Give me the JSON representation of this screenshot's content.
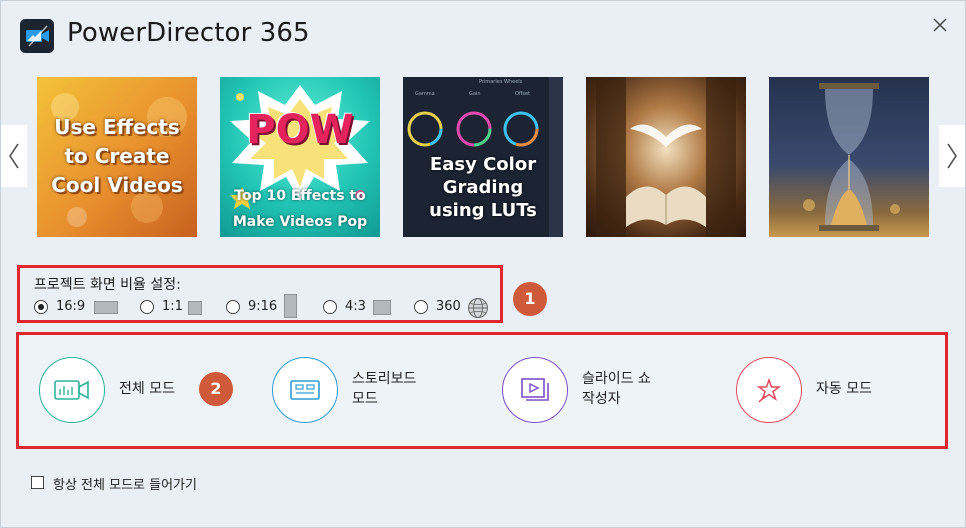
{
  "app": {
    "title": "PowerDirector 365",
    "close_icon": "close-icon"
  },
  "carousel": {
    "items": [
      {
        "caption_lines": [
          "Use Effects",
          "to Create",
          "Cool Videos"
        ]
      },
      {
        "badge": "POW",
        "caption_lines": [
          "Top 10 Effects to",
          "Make Videos Pop"
        ]
      },
      {
        "caption_lines": [
          "Easy Color",
          "Grading",
          "using LUTs"
        ],
        "ui_labels": [
          "Gamma",
          "Gain",
          "Offset",
          "Primaries Wheels"
        ]
      },
      {
        "caption_lines": []
      },
      {
        "caption_lines": []
      }
    ]
  },
  "aspect": {
    "label": "프로젝트 화면 비율 설정:",
    "options": [
      {
        "label": "16:9",
        "checked": true
      },
      {
        "label": "1:1",
        "checked": false
      },
      {
        "label": "9:16",
        "checked": false
      },
      {
        "label": "4:3",
        "checked": false
      },
      {
        "label": "360",
        "checked": false
      }
    ],
    "badge": "1"
  },
  "modes": {
    "items": [
      {
        "label_lines": [
          "전체 모드"
        ],
        "icon": "timeline-camera-icon",
        "color": "#2db29a"
      },
      {
        "label_lines": [
          "스토리보드",
          "모드"
        ],
        "icon": "storyboard-icon",
        "color": "#2e9bd6"
      },
      {
        "label_lines": [
          "슬라이드 쇼",
          "작성자"
        ],
        "icon": "slideshow-icon",
        "color": "#7b4fc9"
      },
      {
        "label_lines": [
          "자동 모드"
        ],
        "icon": "magic-star-icon",
        "color": "#e24b5b"
      }
    ],
    "badge": "2"
  },
  "footer": {
    "always_full_mode_label": "항상 전체 모드로 들어가기",
    "checked": false
  },
  "colors": {
    "highlight": "#e0262f",
    "badge": "#cf5a3a",
    "background": "#e9eff5"
  }
}
